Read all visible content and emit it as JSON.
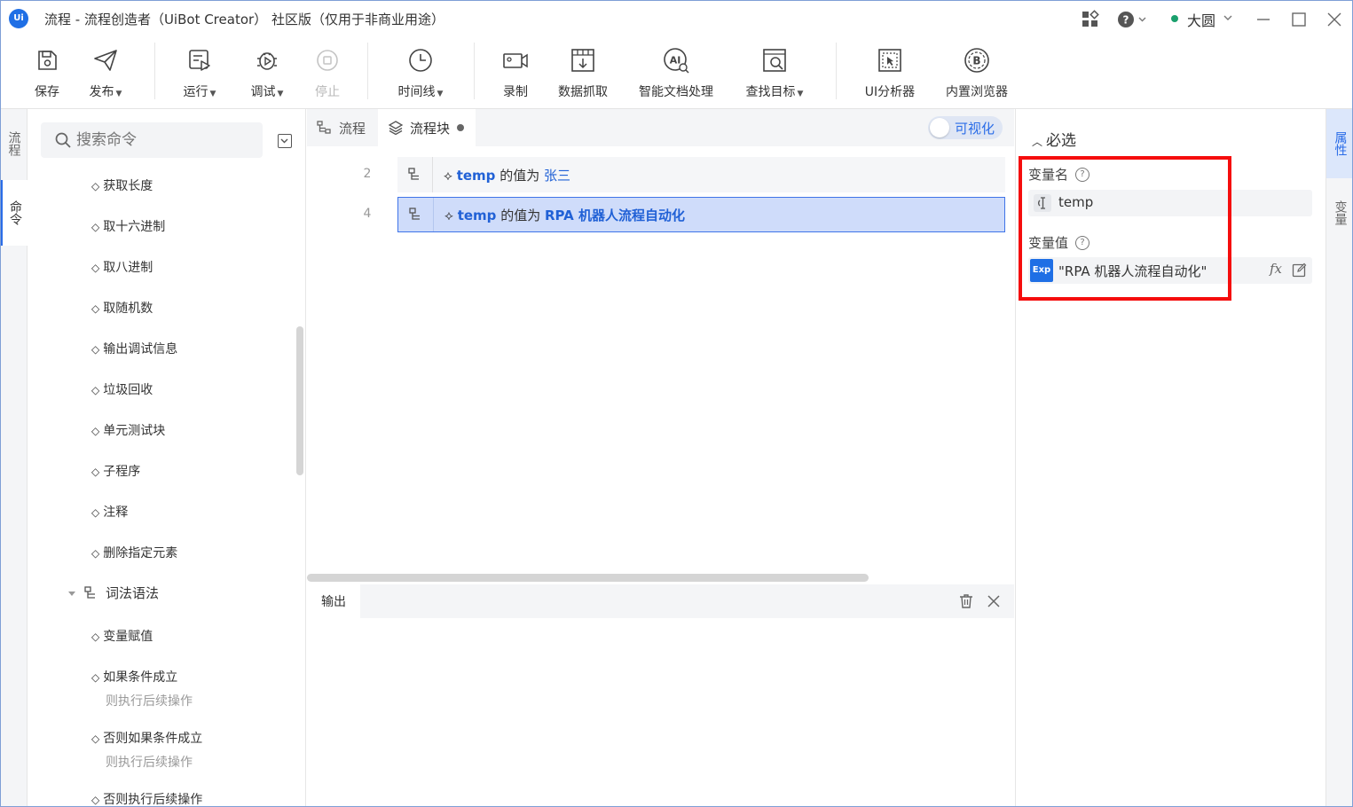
{
  "window": {
    "logo": "Ui",
    "title": "流程 - 流程创造者（UiBot Creator） 社区版（仅用于非商业用途）",
    "user_name": "大圆"
  },
  "toolbar": {
    "save": "保存",
    "publish": "发布",
    "run": "运行",
    "debug": "调试",
    "stop": "停止",
    "timeline": "时间线",
    "record": "录制",
    "data_scrape": "数据抓取",
    "idp": "智能文档处理",
    "find_target": "查找目标",
    "ui_analyzer": "UI分析器",
    "builtin_browser": "内置浏览器"
  },
  "left_tabs": {
    "flow": "流程",
    "commands": "命令"
  },
  "commands": {
    "search_placeholder": "搜索命令",
    "items_top": [
      "获取长度",
      "取十六进制",
      "取八进制",
      "取随机数",
      "输出调试信息",
      "垃圾回收",
      "单元测试块",
      "子程序",
      "注释",
      "删除指定元素"
    ],
    "group": "词法语法",
    "items_group": [
      {
        "label": "变量赋值",
        "sub": ""
      },
      {
        "label": "如果条件成立",
        "sub": "则执行后续操作"
      },
      {
        "label": "否则如果条件成立",
        "sub": "则执行后续操作"
      },
      {
        "label": "否则执行后续操作",
        "sub": ""
      }
    ]
  },
  "editor": {
    "tabs": {
      "flow": "流程",
      "block": "流程块"
    },
    "visual_toggle": "可视化",
    "lines": [
      {
        "no": "2",
        "var": "temp",
        "mid": "的值为",
        "value": "张三"
      },
      {
        "no": "4",
        "var": "temp",
        "mid": "的值为",
        "value": "RPA 机器人流程自动化"
      }
    ]
  },
  "output": {
    "tab": "输出"
  },
  "properties": {
    "section": "必选",
    "var_name_label": "变量名",
    "var_name_value": "temp",
    "var_value_label": "变量值",
    "exp_badge": "Exp",
    "var_value": "\"RPA 机器人流程自动化\"",
    "fx": "fx"
  },
  "right_tabs": {
    "properties": "属性",
    "variables": "变量"
  },
  "colors": {
    "accent": "#2b6de8",
    "highlight": "#f50d0d",
    "selected_row": "#cfdcfa"
  }
}
